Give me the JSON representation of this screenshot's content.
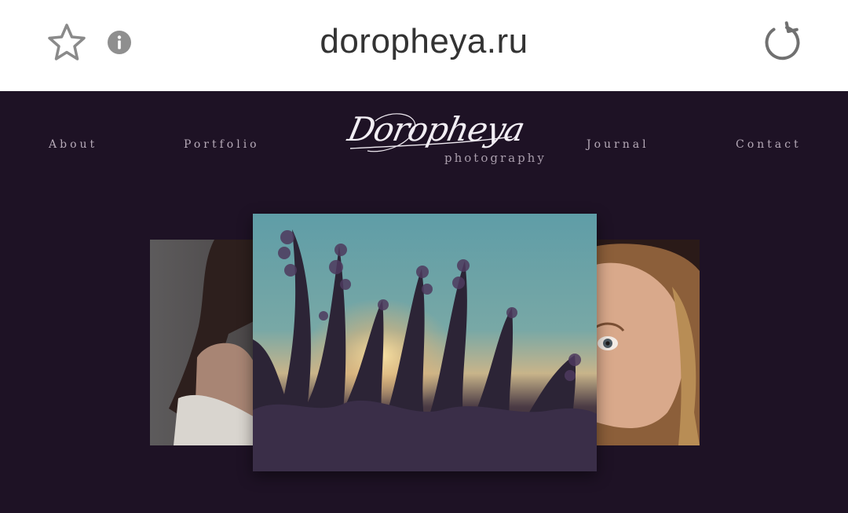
{
  "browser": {
    "url": "dorophеya.ru",
    "icons": {
      "bookmark": "star-icon",
      "site_info": "info-icon",
      "reload": "reload-icon"
    }
  },
  "site": {
    "nav": {
      "about": "About",
      "portfolio": "Portfolio",
      "journal": "Journal",
      "contact": "Contact"
    },
    "logo": {
      "script": "Doropheya",
      "tagline": "photography"
    },
    "carousel": {
      "slides": [
        {
          "name": "woman-with-curly-hair-photo"
        },
        {
          "name": "lavender-sunset-photo"
        },
        {
          "name": "blonde-woman-portrait-photo"
        }
      ]
    }
  },
  "colors": {
    "background": "#1e1225",
    "nav_text": "#b6aab8",
    "logo_text": "#f2eef4",
    "addressbar": "#ffffff",
    "url_text": "#333333"
  }
}
